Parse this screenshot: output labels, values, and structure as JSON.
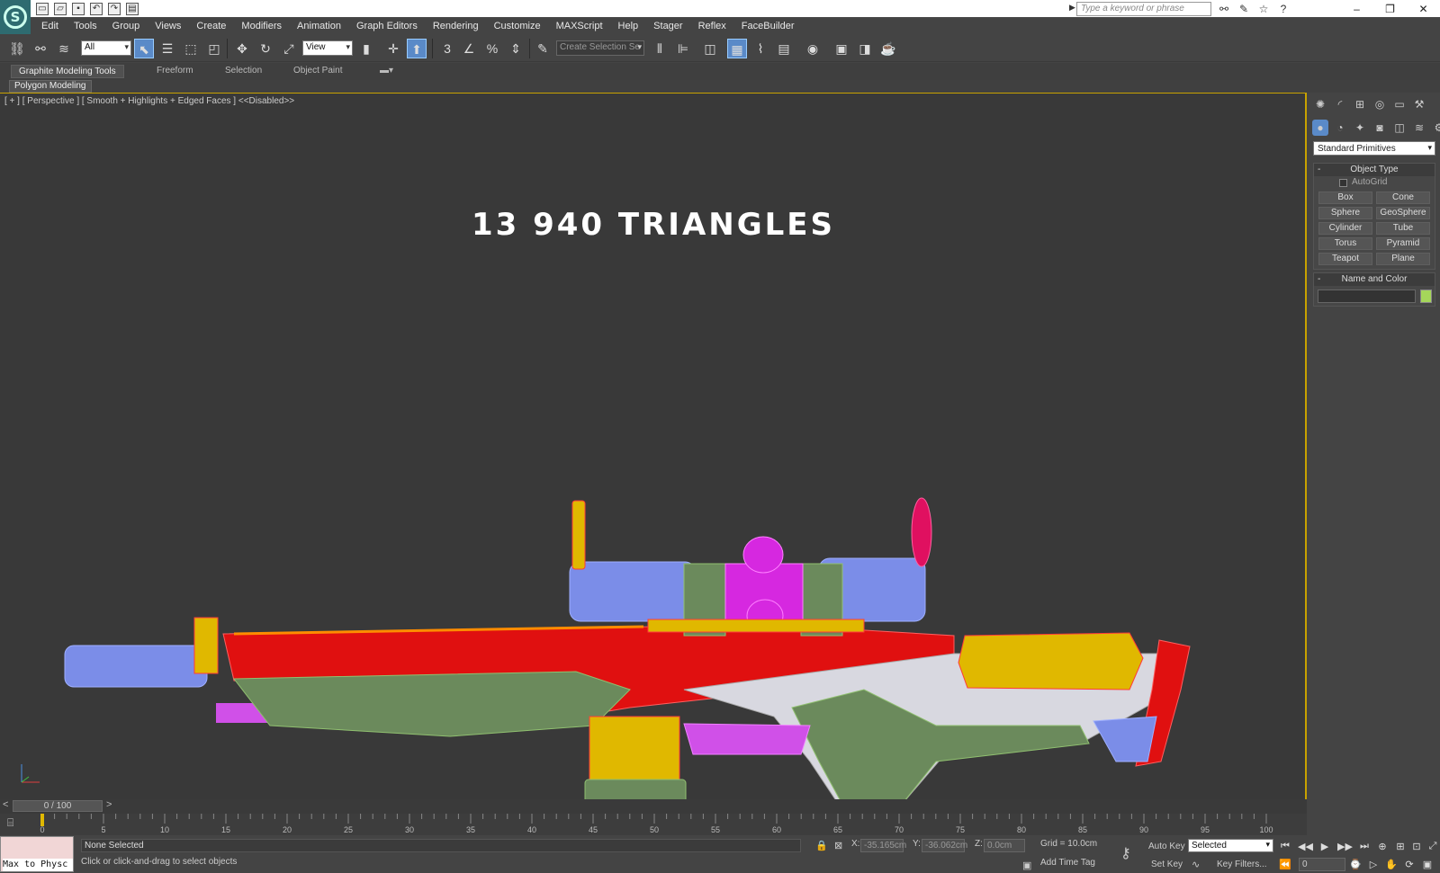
{
  "app": {
    "search_placeholder": "Type a keyword or phrase",
    "logo_letter": "S"
  },
  "menu": [
    "Edit",
    "Tools",
    "Group",
    "Views",
    "Create",
    "Modifiers",
    "Animation",
    "Graph Editors",
    "Rendering",
    "Customize",
    "MAXScript",
    "Help",
    "Stager",
    "Reflex",
    "FaceBuilder"
  ],
  "toolbar": {
    "selection_filter": "All",
    "ref_coord": "View",
    "named_selection_placeholder": "Create Selection Se",
    "snap_labels": [
      "3",
      "%"
    ]
  },
  "ribbon": {
    "tabs": [
      "Graphite Modeling Tools",
      "Freeform",
      "Selection",
      "Object Paint"
    ],
    "active_tab": "Graphite Modeling Tools",
    "panel_label": "Polygon Modeling"
  },
  "viewport": {
    "label": "[ + ] [ Perspective ] [ Smooth + Highlights + Edged Faces ] <<Disabled>>",
    "overlay_title": "13 940 TRIANGLES"
  },
  "command_panel": {
    "category": "Standard Primitives",
    "object_type": {
      "title": "Object Type",
      "autogrid_label": "AutoGrid",
      "buttons": [
        "Box",
        "Cone",
        "Sphere",
        "GeoSphere",
        "Cylinder",
        "Tube",
        "Torus",
        "Pyramid",
        "Teapot",
        "Plane"
      ]
    },
    "name_and_color": {
      "title": "Name and Color",
      "color": "#a5d65a"
    }
  },
  "timeline": {
    "slider_text": "0 / 100",
    "ticks": [
      "0",
      "5",
      "10",
      "15",
      "20",
      "25",
      "30",
      "35",
      "40",
      "45",
      "50",
      "55",
      "60",
      "65",
      "70",
      "75",
      "80",
      "85",
      "90",
      "95",
      "100"
    ]
  },
  "status": {
    "maxscript_text": "Max to Physc",
    "selection": "None Selected",
    "prompt": "Click or click-and-drag to select objects",
    "x_label": "X:",
    "x_value": "-35.165cm",
    "y_label": "Y:",
    "y_value": "-36.062cm",
    "z_label": "Z:",
    "z_value": "0.0cm",
    "grid": "Grid = 10.0cm",
    "add_time_tag": "Add Time Tag",
    "auto_key": "Auto Key",
    "set_key": "Set Key",
    "key_mode": "Selected",
    "key_filters": "Key Filters...",
    "current_frame": "0"
  }
}
